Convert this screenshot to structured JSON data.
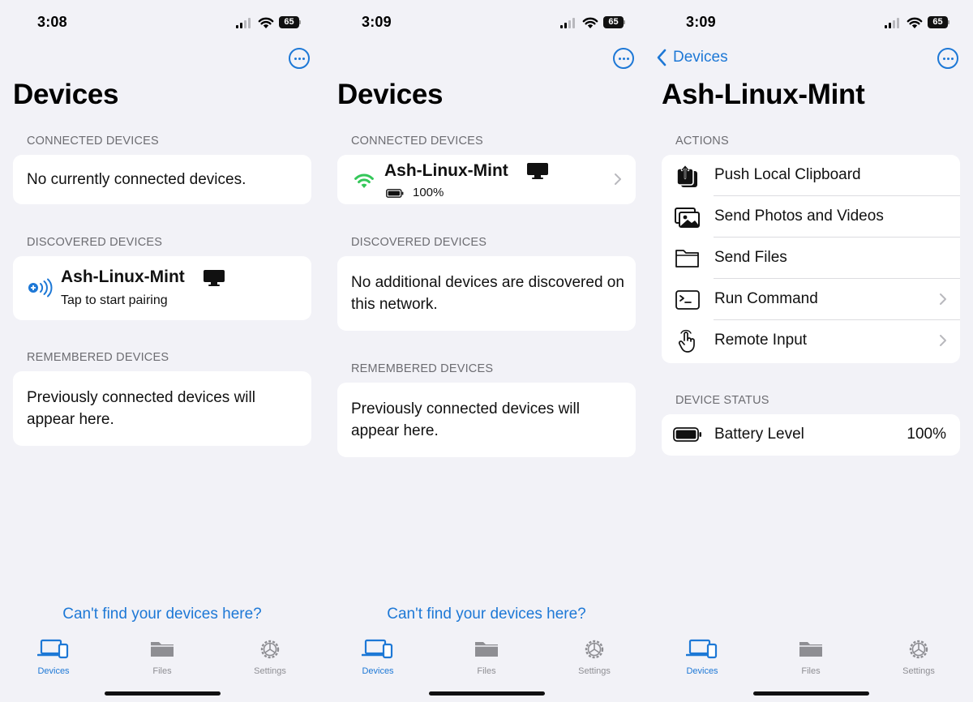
{
  "status_times": [
    "3:08",
    "3:09",
    "3:09"
  ],
  "status_battery": "65",
  "screen1": {
    "title": "Devices",
    "connected_header": "CONNECTED DEVICES",
    "connected_empty": "No currently connected devices.",
    "discovered_header": "DISCOVERED DEVICES",
    "discovered_device_name": "Ash-Linux-Mint",
    "discovered_device_sub": "Tap to start pairing",
    "remembered_header": "REMEMBERED DEVICES",
    "remembered_empty": "Previously connected devices will appear here.",
    "help_link": "Can't find your devices here?"
  },
  "screen2": {
    "title": "Devices",
    "connected_header": "CONNECTED DEVICES",
    "connected_device_name": "Ash-Linux-Mint",
    "connected_device_battery": "100%",
    "discovered_header": "DISCOVERED DEVICES",
    "discovered_empty": "No additional devices are discovered on this network.",
    "remembered_header": "REMEMBERED DEVICES",
    "remembered_empty": "Previously connected devices will appear here.",
    "help_link": "Can't find your devices here?"
  },
  "screen3": {
    "back_label": "Devices",
    "title": "Ash-Linux-Mint",
    "actions_header": "ACTIONS",
    "actions": [
      {
        "label": "Push Local Clipboard",
        "icon": "clipboard-upload-icon"
      },
      {
        "label": "Send Photos and Videos",
        "icon": "photos-icon"
      },
      {
        "label": "Send Files",
        "icon": "folder-icon"
      },
      {
        "label": "Run Command",
        "icon": "terminal-icon"
      },
      {
        "label": "Remote Input",
        "icon": "hand-pointer-icon"
      }
    ],
    "status_header": "DEVICE STATUS",
    "battery_label": "Battery Level",
    "battery_value": "100%"
  },
  "tabs": [
    {
      "label": "Devices",
      "icon": "laptop-phone-icon"
    },
    {
      "label": "Files",
      "icon": "folder-icon"
    },
    {
      "label": "Settings",
      "icon": "gear-icon"
    }
  ],
  "colors": {
    "accent": "#1d78d6",
    "connected": "#34c759",
    "background": "#f2f2f7"
  }
}
